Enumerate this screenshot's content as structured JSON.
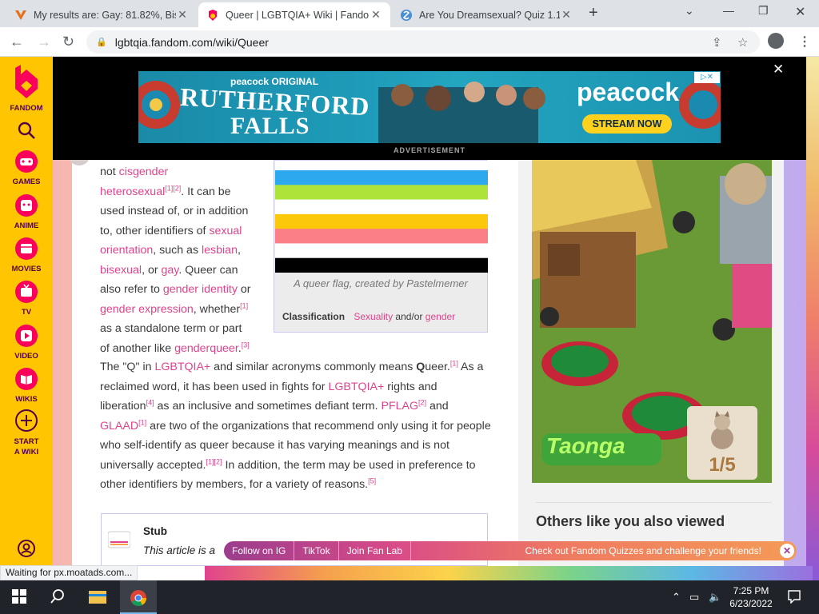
{
  "browser": {
    "tabs": [
      {
        "title": "My results are: Gay: 81.82%, Bise",
        "active": false
      },
      {
        "title": "Queer | LGBTQIA+ Wiki | Fandom",
        "active": true
      },
      {
        "title": "Are You Dreamsexual? Quiz 1.19/",
        "active": false
      }
    ],
    "url": "lgbtqia.fandom.com/wiki/Queer",
    "status": "Waiting for px.moatads.com..."
  },
  "fandom_bar": {
    "logo": "FANDOM",
    "items": [
      "GAMES",
      "ANIME",
      "MOVIES",
      "TV",
      "VIDEO",
      "WIKIS",
      "START A WIKI"
    ]
  },
  "ad": {
    "label": "ADVERTISEMENT",
    "brand_top": "peacock ORIGINAL",
    "title_line1": "RUTHERFORD",
    "title_line2": "FALLS",
    "brand": "peacock",
    "cta": "STREAM NOW"
  },
  "article": {
    "lines": [
      {
        "pre": "not ",
        "link": "cisgender",
        "post": "",
        "sup": ""
      },
      {
        "pre": "",
        "link": "heterosexual",
        "post": ". It can be",
        "sup": "[1][2]"
      },
      {
        "pre": "used instead of, or in addition",
        "link": "",
        "post": "",
        "sup": ""
      },
      {
        "pre": "to, other identifiers of ",
        "link": "sexual",
        "post": "",
        "sup": ""
      },
      {
        "pre": "",
        "link": "orientation",
        "post": ", such as ",
        "link2": "lesbian",
        "post2": ",",
        "sup": ""
      },
      {
        "pre": "",
        "link": "bisexual",
        "post": ", or ",
        "link2": "gay",
        "post2": ". Queer can",
        "sup": ""
      },
      {
        "pre": "also refer to ",
        "link": "gender identity",
        "post": " or",
        "sup": ""
      },
      {
        "pre": "",
        "link": "gender expression",
        "post": ", whether",
        "sup": "[1]"
      },
      {
        "pre": "as a standalone term or part",
        "link": "",
        "post": "",
        "sup": ""
      },
      {
        "pre": "of another like ",
        "link": "genderqueer",
        "post": ".",
        "sup": "[3]"
      }
    ],
    "paragraph": [
      {
        "t": "text",
        "v": "The \"Q\" in "
      },
      {
        "t": "link",
        "v": "LGBTQIA+"
      },
      {
        "t": "text",
        "v": " and similar acronyms commonly means "
      },
      {
        "t": "bold",
        "v": "Q"
      },
      {
        "t": "text",
        "v": "ueer."
      },
      {
        "t": "sup",
        "v": "[1]"
      },
      {
        "t": "text",
        "v": " As a reclaimed word, it has been used in fights for "
      },
      {
        "t": "link",
        "v": "LGBTQIA+"
      },
      {
        "t": "text",
        "v": " rights and liberation"
      },
      {
        "t": "sup",
        "v": "[4]"
      },
      {
        "t": "text",
        "v": " as an inclusive and sometimes defiant term. "
      },
      {
        "t": "link",
        "v": "PFLAG"
      },
      {
        "t": "sup",
        "v": "[2]"
      },
      {
        "t": "text",
        "v": " and "
      },
      {
        "t": "link",
        "v": "GLAAD"
      },
      {
        "t": "sup",
        "v": "[1]"
      },
      {
        "t": "text",
        "v": " are two of the organizations that recommend only using it for people who self-identify as queer because it has varying meanings and is not universally accepted."
      },
      {
        "t": "sup",
        "v": "[1][2]"
      },
      {
        "t": "text",
        "v": " In addition, the term may be used in preference to other identifiers by members, for a variety of reasons."
      },
      {
        "t": "sup",
        "v": "[5]"
      }
    ]
  },
  "infobox": {
    "caption": "A queer flag, created by Pastelmemer",
    "classification_label": "Classification",
    "classification_link1": "Sexuality",
    "classification_mid": "and/or",
    "classification_link2": "gender",
    "flag_colors": [
      "#2ba8ee",
      "#aee43a",
      "#ffffff",
      "#fcc80a",
      "#fb7f86",
      "#ffffff",
      "#000000"
    ]
  },
  "stub": {
    "title": "Stub",
    "text": "This article is a"
  },
  "rightrail": {
    "game_brand": "Taonga",
    "counter": "1/5",
    "others_heading": "Others like you also viewed"
  },
  "promo": {
    "links": [
      "Follow on IG",
      "TikTok",
      "Join Fan Lab"
    ],
    "message": "Check out Fandom Quizzes and challenge your friends!"
  },
  "taskbar": {
    "time": "7:25 PM",
    "date": "6/23/2022"
  }
}
